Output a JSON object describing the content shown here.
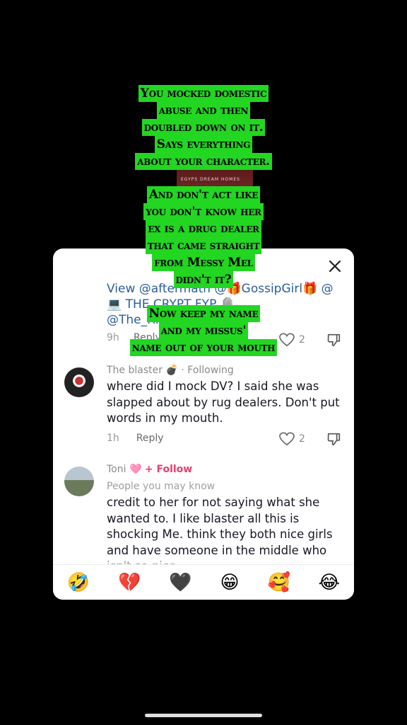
{
  "overlay_text": {
    "block1": [
      "You mocked domestic",
      "abuse and then",
      "doubled down on it.",
      "Says everything",
      "about your character."
    ],
    "block2": [
      "And don't act like",
      "you don't know her",
      "ex is a drug dealer",
      "that came straight",
      "from Messy Mel",
      "didn't it?"
    ],
    "block3": [
      "Now keep my name",
      "and my missus'",
      "name out of your mouth"
    ]
  },
  "video_thumb_caption": "EGYPS DREAM HOMES",
  "partial_comment": {
    "text": "View @aftermath @🎁GossipGirl🎁 @💻 THE CRYPT FYP 🪦 @The_Ricksta_Realm 😈",
    "time": "9h",
    "reply": "Reply",
    "likes": "2"
  },
  "comments": [
    {
      "user": "The blaster",
      "user_badge": "💣",
      "relation": "· Following",
      "text": "where did I mock DV? I said she was slapped about by rug dealers. Don't put words in my mouth.",
      "time": "1h",
      "reply": "Reply",
      "likes": "2"
    },
    {
      "user": "Toni",
      "user_badge": "🩷",
      "follow": "+ Follow",
      "subtitle": "People you may know",
      "text": "credit to her for not saying what she wanted to. I like blaster all this is shocking Me. think they both nice girls and have someone in the middle who isn't so nice"
    }
  ],
  "emoji_bar": [
    "🤣",
    "💔",
    "🖤",
    "😁",
    "🥰",
    "😂"
  ],
  "icons": [
    "close-icon",
    "heart-outline-icon",
    "dislike-icon"
  ]
}
